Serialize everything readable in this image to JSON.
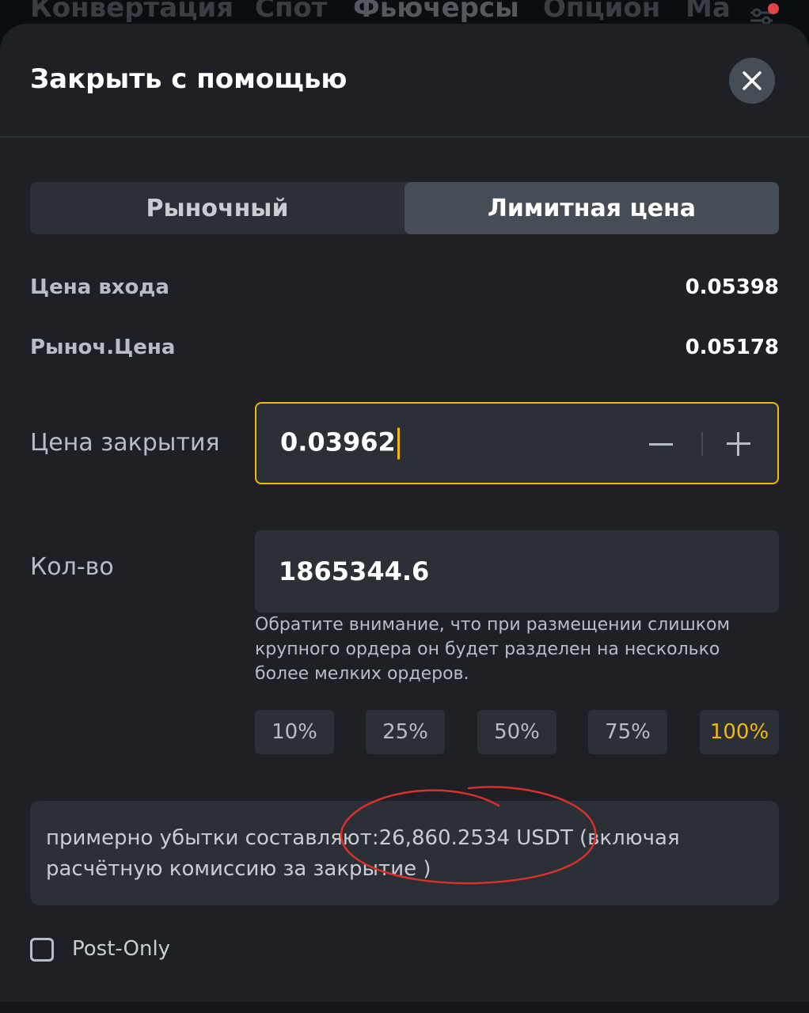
{
  "top_nav": {
    "items": [
      "Конвертация",
      "Спот",
      "Фьючерсы",
      "Опцион",
      "Ма"
    ]
  },
  "sheet": {
    "title": "Закрыть с помощью",
    "close_icon": "close-icon"
  },
  "order_type": {
    "options": [
      "Рыночный",
      "Лимитная цена"
    ],
    "selected": "Лимитная цена"
  },
  "info": [
    {
      "label": "Цена входа",
      "value": "0.05398"
    },
    {
      "label": "Рыноч.Цена",
      "value": "0.05178"
    }
  ],
  "close_price": {
    "label": "Цена закрытия",
    "value": "0.03962"
  },
  "quantity": {
    "label": "Кол-во",
    "value": "1865344.6",
    "notice": "Обратите внимание, что при размещении слишком крупного ордера он будет разделен на несколько более мелких ордеров."
  },
  "percent_options": [
    "10%",
    "25%",
    "50%",
    "75%",
    "100%"
  ],
  "percent_selected": "100%",
  "estimate": {
    "text": "примерно убытки составляют:26,860.2534 USDT (включая расчётную комиссию за закрытие  )"
  },
  "post_only": {
    "label": "Post-Only",
    "checked": false
  },
  "colors": {
    "accent": "#f0b90b",
    "background": "#1e2026",
    "field": "#2b2f36",
    "annotation": "#d9302a"
  }
}
